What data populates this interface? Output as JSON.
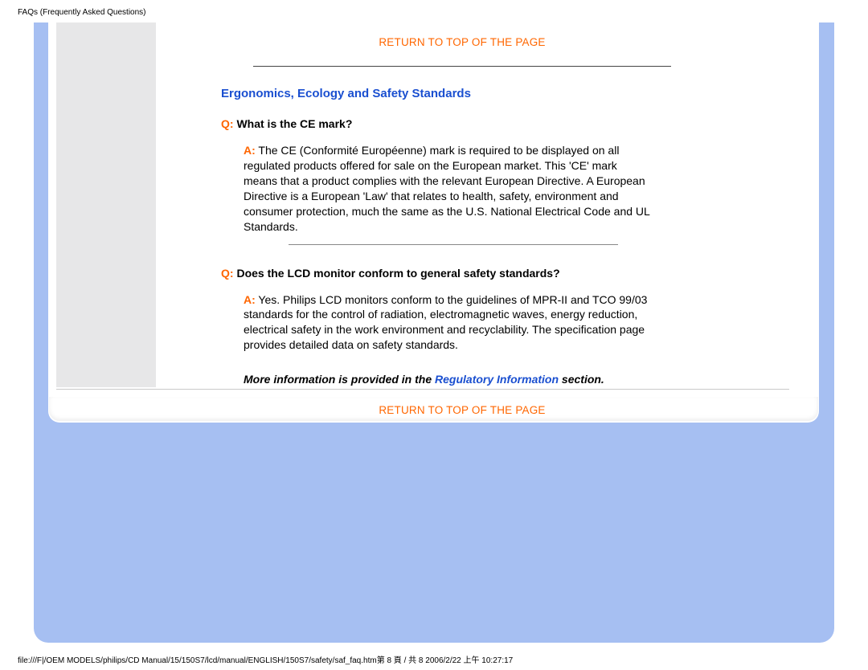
{
  "header": {
    "title": "FAQs (Frequently Asked Questions)"
  },
  "link_return": "RETURN TO TOP OF THE PAGE",
  "section": {
    "title": "Ergonomics, Ecology and Safety Standards"
  },
  "q1": {
    "q_label": "Q:",
    "question": " What is the CE mark?",
    "a_label": "A:",
    "answer": " The CE (Conformité Européenne) mark is required to be displayed on all regulated products offered for sale on the European market. This 'CE' mark means that a product complies with the relevant European Directive. A European Directive is a European 'Law' that relates to health, safety, environment and consumer protection, much the same as the U.S. National Electrical Code and UL Standards."
  },
  "q2": {
    "q_label": "Q:",
    "question": " Does the LCD monitor conform to general safety standards?",
    "a_label": "A:",
    "answer": " Yes. Philips LCD monitors conform to the guidelines of MPR-II and TCO 99/03 standards for the control of radiation, electromagnetic waves, energy reduction, electrical safety in the work environment and recyclability. The specification page provides detailed data on safety standards."
  },
  "more_info": {
    "pre": "More information is provided in the ",
    "link": "Regulatory Information",
    "post": " section."
  },
  "footer": {
    "path": "file:///F|/OEM MODELS/philips/CD Manual/15/150S7/lcd/manual/ENGLISH/150S7/safety/saf_faq.htm第 8 頁 / 共 8 2006/2/22 上午 10:27:17"
  }
}
